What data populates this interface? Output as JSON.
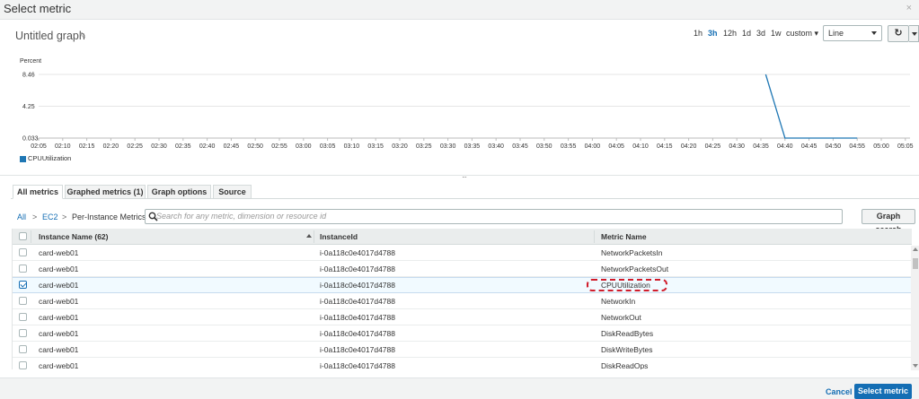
{
  "modal": {
    "title": "Select metric",
    "close_symbol": "×"
  },
  "graph": {
    "title": "Untitled graph",
    "time_ranges": [
      "1h",
      "3h",
      "12h",
      "1d",
      "3d",
      "1w",
      "custom"
    ],
    "active_range": "3h",
    "graph_type": "Line"
  },
  "chart_data": {
    "type": "line",
    "ylabel": "Percent",
    "y_ticks": [
      "8.46",
      "4.25",
      "0.033"
    ],
    "ylim": [
      0.033,
      8.46
    ],
    "x_ticks": [
      "02:05",
      "02:10",
      "02:15",
      "02:20",
      "02:25",
      "02:30",
      "02:35",
      "02:40",
      "02:45",
      "02:50",
      "02:55",
      "03:00",
      "03:05",
      "03:10",
      "03:15",
      "03:20",
      "03:25",
      "03:30",
      "03:35",
      "03:40",
      "03:45",
      "03:50",
      "03:55",
      "04:00",
      "04:05",
      "04:10",
      "04:15",
      "04:20",
      "04:25",
      "04:30",
      "04:35",
      "04:40",
      "04:45",
      "04:50",
      "04:55",
      "05:00",
      "05:05"
    ],
    "series": [
      {
        "name": "CPUUtilization",
        "color": "#1f77b4",
        "x": [
          "04:36",
          "04:40",
          "04:45",
          "04:50",
          "04:55"
        ],
        "y": [
          8.46,
          0.033,
          0.033,
          0.033,
          0.033
        ]
      }
    ],
    "grid": true,
    "legend": "bottom-left"
  },
  "tabs": [
    {
      "label": "All metrics",
      "active": true
    },
    {
      "label": "Graphed metrics (1)",
      "active": false
    },
    {
      "label": "Graph options",
      "active": false
    },
    {
      "label": "Source",
      "active": false
    }
  ],
  "breadcrumb": {
    "all": "All",
    "ec2": "EC2",
    "current": "Per-Instance Metrics",
    "sep": ">"
  },
  "search": {
    "placeholder": "Search for any metric, dimension or resource id",
    "button": "Graph search"
  },
  "table": {
    "headers": {
      "instance_name": "Instance Name (62)",
      "instance_id": "InstanceId",
      "metric_name": "Metric Name"
    },
    "rows": [
      {
        "name": "card-web01",
        "id": "i-0a118c0e4017d4788",
        "metric": "NetworkPacketsIn",
        "checked": false
      },
      {
        "name": "card-web01",
        "id": "i-0a118c0e4017d4788",
        "metric": "NetworkPacketsOut",
        "checked": false
      },
      {
        "name": "card-web01",
        "id": "i-0a118c0e4017d4788",
        "metric": "CPUUtilization",
        "checked": true
      },
      {
        "name": "card-web01",
        "id": "i-0a118c0e4017d4788",
        "metric": "NetworkIn",
        "checked": false
      },
      {
        "name": "card-web01",
        "id": "i-0a118c0e4017d4788",
        "metric": "NetworkOut",
        "checked": false
      },
      {
        "name": "card-web01",
        "id": "i-0a118c0e4017d4788",
        "metric": "DiskReadBytes",
        "checked": false
      },
      {
        "name": "card-web01",
        "id": "i-0a118c0e4017d4788",
        "metric": "DiskWriteBytes",
        "checked": false
      },
      {
        "name": "card-web01",
        "id": "i-0a118c0e4017d4788",
        "metric": "DiskReadOps",
        "checked": false
      }
    ]
  },
  "footer": {
    "cancel": "Cancel",
    "select": "Select metric"
  }
}
